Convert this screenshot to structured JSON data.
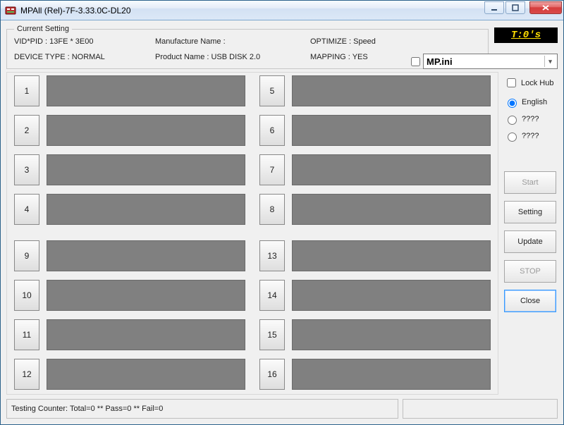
{
  "window": {
    "title": "MPAll (Rel)-7F-3.33.0C-DL20"
  },
  "settings_group": {
    "legend": "Current Setting",
    "vid_pid": "VID*PID : 13FE * 3E00",
    "device_type": "DEVICE TYPE : NORMAL",
    "manufacture_name": "Manufacture Name :",
    "product_name": "Product Name : USB DISK 2.0",
    "optimize": "OPTIMIZE : Speed",
    "mapping": "MAPPING : YES"
  },
  "timer": "T:0's",
  "combo": {
    "checked": false,
    "value": "MP.ini"
  },
  "lock_hub": {
    "label": "Lock Hub",
    "checked": false
  },
  "languages": {
    "selected": 0,
    "options": [
      "English",
      "????",
      "????"
    ]
  },
  "slots": {
    "left": [
      "1",
      "2",
      "3",
      "4",
      "9",
      "10",
      "11",
      "12"
    ],
    "right": [
      "5",
      "6",
      "7",
      "8",
      "13",
      "14",
      "15",
      "16"
    ]
  },
  "buttons": {
    "start": "Start",
    "setting": "Setting",
    "update": "Update",
    "stop": "STOP",
    "close": "Close"
  },
  "status": {
    "left": "Testing Counter: Total=0 ** Pass=0 ** Fail=0",
    "right": ""
  }
}
